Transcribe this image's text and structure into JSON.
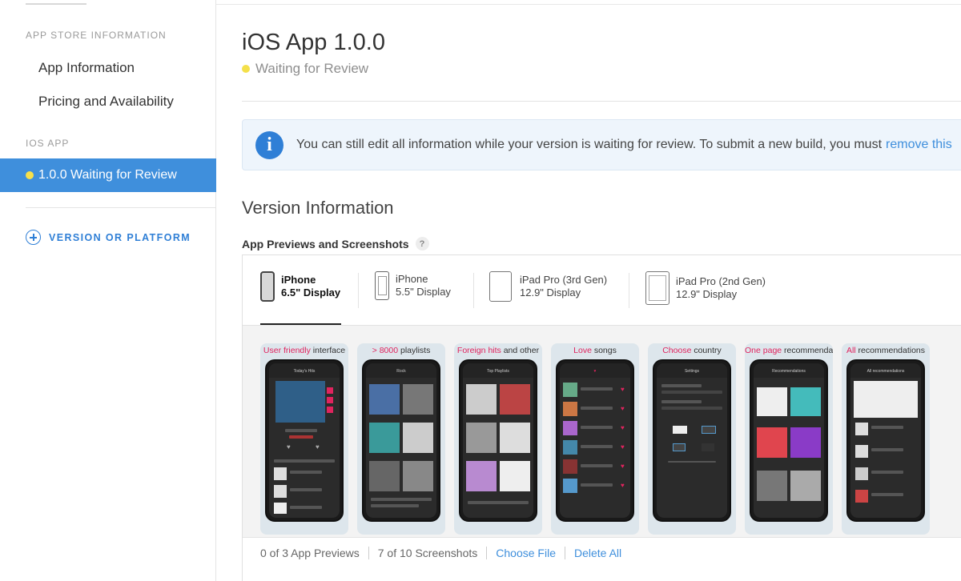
{
  "sidebar": {
    "section_store": "APP STORE INFORMATION",
    "item_app_info": "App Information",
    "item_pricing": "Pricing and Availability",
    "section_ios": "IOS APP",
    "active_item": "1.0.0 Waiting for Review",
    "add_version": "VERSION OR PLATFORM"
  },
  "main": {
    "title": "iOS App 1.0.0",
    "status": "Waiting for Review",
    "banner_text": "You can still edit all information while your version is waiting for review. To submit a new build, you must",
    "banner_link": "remove this",
    "section_title": "Version Information",
    "previews_label": "App Previews and Screenshots",
    "help": "?"
  },
  "devices": [
    {
      "line1": "iPhone",
      "line2": "6.5\" Display"
    },
    {
      "line1": "iPhone",
      "line2": "5.5\" Display"
    },
    {
      "line1": "iPad Pro (3rd Gen)",
      "line2": "12.9\" Display"
    },
    {
      "line1": "iPad Pro (2nd Gen)",
      "line2": "12.9\" Display"
    }
  ],
  "screenshots": [
    {
      "hl": "User friendly",
      "rest": " interface",
      "screen": "Today's Hits"
    },
    {
      "hl": "> 8000",
      "rest": " playlists",
      "screen": "Rock"
    },
    {
      "hl": "Foreign hits",
      "rest": " and other",
      "screen": "Top Playlists"
    },
    {
      "hl": "Love",
      "rest": " songs",
      "screen": ""
    },
    {
      "hl": "Choose",
      "rest": " country",
      "screen": "Settings"
    },
    {
      "hl": "One page",
      "rest": " recommendations",
      "screen": "Recommendations"
    },
    {
      "hl": "All",
      "rest": " recommendations",
      "screen": "All recommendations"
    }
  ],
  "footer": {
    "previews": "0 of 3 App Previews",
    "screenshots": "7 of 10 Screenshots",
    "choose_file": "Choose File",
    "delete_all": "Delete All"
  },
  "colors": {
    "accent": "#3f8fdc",
    "status_yellow": "#f4e04a",
    "highlight_pink": "#e0245e"
  }
}
